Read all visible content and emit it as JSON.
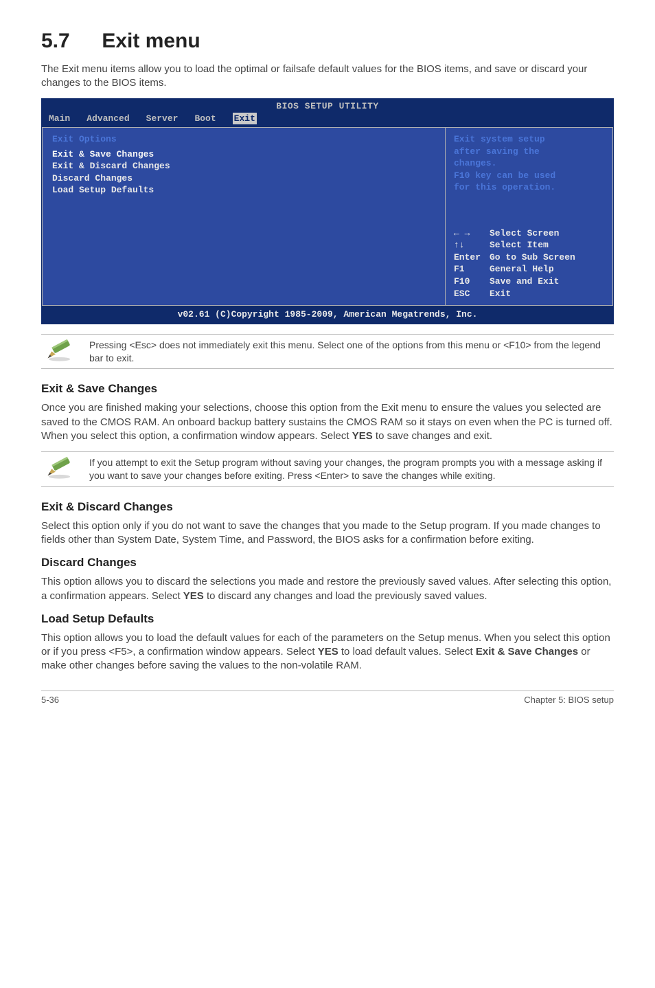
{
  "heading": {
    "num": "5.7",
    "title": "Exit menu"
  },
  "intro": "The Exit menu items allow you to load the optimal or failsafe default values for the BIOS items, and save or discard your changes to the BIOS items.",
  "bios": {
    "title": "BIOS SETUP UTILITY",
    "tabs": [
      "Main",
      "Advanced",
      "Server",
      "Boot",
      "Exit"
    ],
    "active_tab": "Exit",
    "left_header": "Exit Options",
    "left_items": [
      "Exit & Save Changes",
      "Exit & Discard Changes",
      "Discard Changes",
      "",
      "Load Setup Defaults"
    ],
    "right_help_lines": [
      "Exit system setup",
      "after saving the",
      "changes.",
      "",
      "F10 key can be used",
      "for this operation."
    ],
    "nav": [
      {
        "key": "←  →",
        "label": "Select Screen"
      },
      {
        "key": "↑↓",
        "label": "Select Item"
      },
      {
        "key": "Enter",
        "label": "Go to Sub Screen"
      },
      {
        "key": "F1",
        "label": "General Help"
      },
      {
        "key": "F10",
        "label": "Save and Exit"
      },
      {
        "key": "ESC",
        "label": "Exit"
      }
    ],
    "footer": "v02.61 (C)Copyright 1985-2009, American Megatrends, Inc."
  },
  "note1": "Pressing <Esc> does not immediately exit this menu. Select one of the options from this menu or <F10> from the legend bar to exit.",
  "sections": {
    "s1": {
      "h": "Exit & Save Changes",
      "p_a": "Once you are finished making your selections, choose this option from the Exit menu to ensure the values you selected are saved to the CMOS RAM. An onboard backup battery sustains the CMOS RAM so it stays on even when the PC is turned off. When you select this option, a confirmation window appears. Select ",
      "p_b": "YES",
      "p_c": " to save changes and exit."
    },
    "note2": "If you attempt to exit the Setup program without saving your changes, the program prompts you with a message asking if you want to save your changes before exiting. Press <Enter> to save the changes while exiting.",
    "s2": {
      "h": "Exit & Discard Changes",
      "p": "Select this option only if you do not want to save the changes that you made to the Setup program. If you made changes to fields other than System Date, System Time, and Password, the BIOS asks for a confirmation before exiting."
    },
    "s3": {
      "h": "Discard Changes",
      "p_a": "This option allows you to discard the selections you made and restore the previously saved values. After selecting this option, a confirmation appears. Select ",
      "p_b": "YES",
      "p_c": " to discard any changes and load the previously saved values."
    },
    "s4": {
      "h": "Load Setup Defaults",
      "p_a": "This option allows you to load the default values for each of the parameters on the Setup menus. When you select this option or if you press <F5>, a confirmation window appears. Select ",
      "p_b": "YES",
      "p_c": " to load default values. Select ",
      "p_d": "Exit & Save Changes",
      "p_e": " or make other changes before saving the values to the non-volatile RAM."
    }
  },
  "footer": {
    "left": "5-36",
    "right": "Chapter 5: BIOS setup"
  }
}
